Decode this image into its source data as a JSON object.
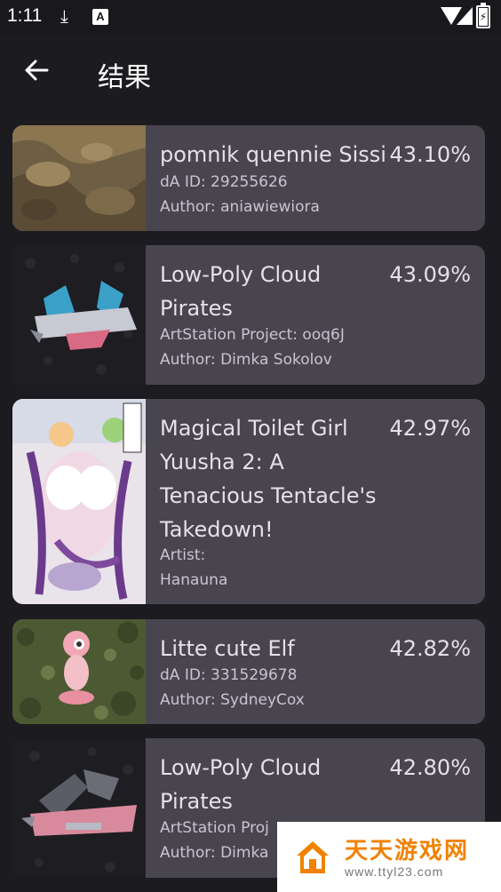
{
  "status_bar": {
    "time": "1:11",
    "download_icon": "download-icon",
    "a_badge": "A"
  },
  "app_bar": {
    "back_icon": "arrow-left-icon",
    "title": "结果"
  },
  "results": [
    {
      "title": "pomnik quennie Sissi",
      "similarity": "43.10%",
      "line1": "dA ID: 29255626",
      "line2": "Author: aniawiewiora"
    },
    {
      "title": "Low-Poly Cloud Pirates",
      "similarity": "43.09%",
      "line1": "ArtStation Project: ooq6J",
      "line2": "Author: Dimka Sokolov"
    },
    {
      "title": "Magical Toilet Girl Yuusha 2: A Tenacious Tentacle's Takedown!",
      "similarity": "42.97%",
      "line1": "Artist:",
      "line2": "Hanauna"
    },
    {
      "title": "Litte cute Elf",
      "similarity": "42.82%",
      "line1": "dA ID: 331529678",
      "line2": "Author: SydneyCox"
    },
    {
      "title": "Low-Poly Cloud Pirates",
      "similarity": "42.80%",
      "line1": "ArtStation Proj",
      "line2": "Author: Dimka"
    }
  ],
  "watermark": {
    "cn": "天天游戏网",
    "url": "www.ttyl23.com"
  },
  "colors": {
    "background": "#1c1b1f",
    "card": "#49454f",
    "text": "#e6e1e5",
    "subtext": "#cac4d0",
    "watermark_orange": "#f08200"
  }
}
